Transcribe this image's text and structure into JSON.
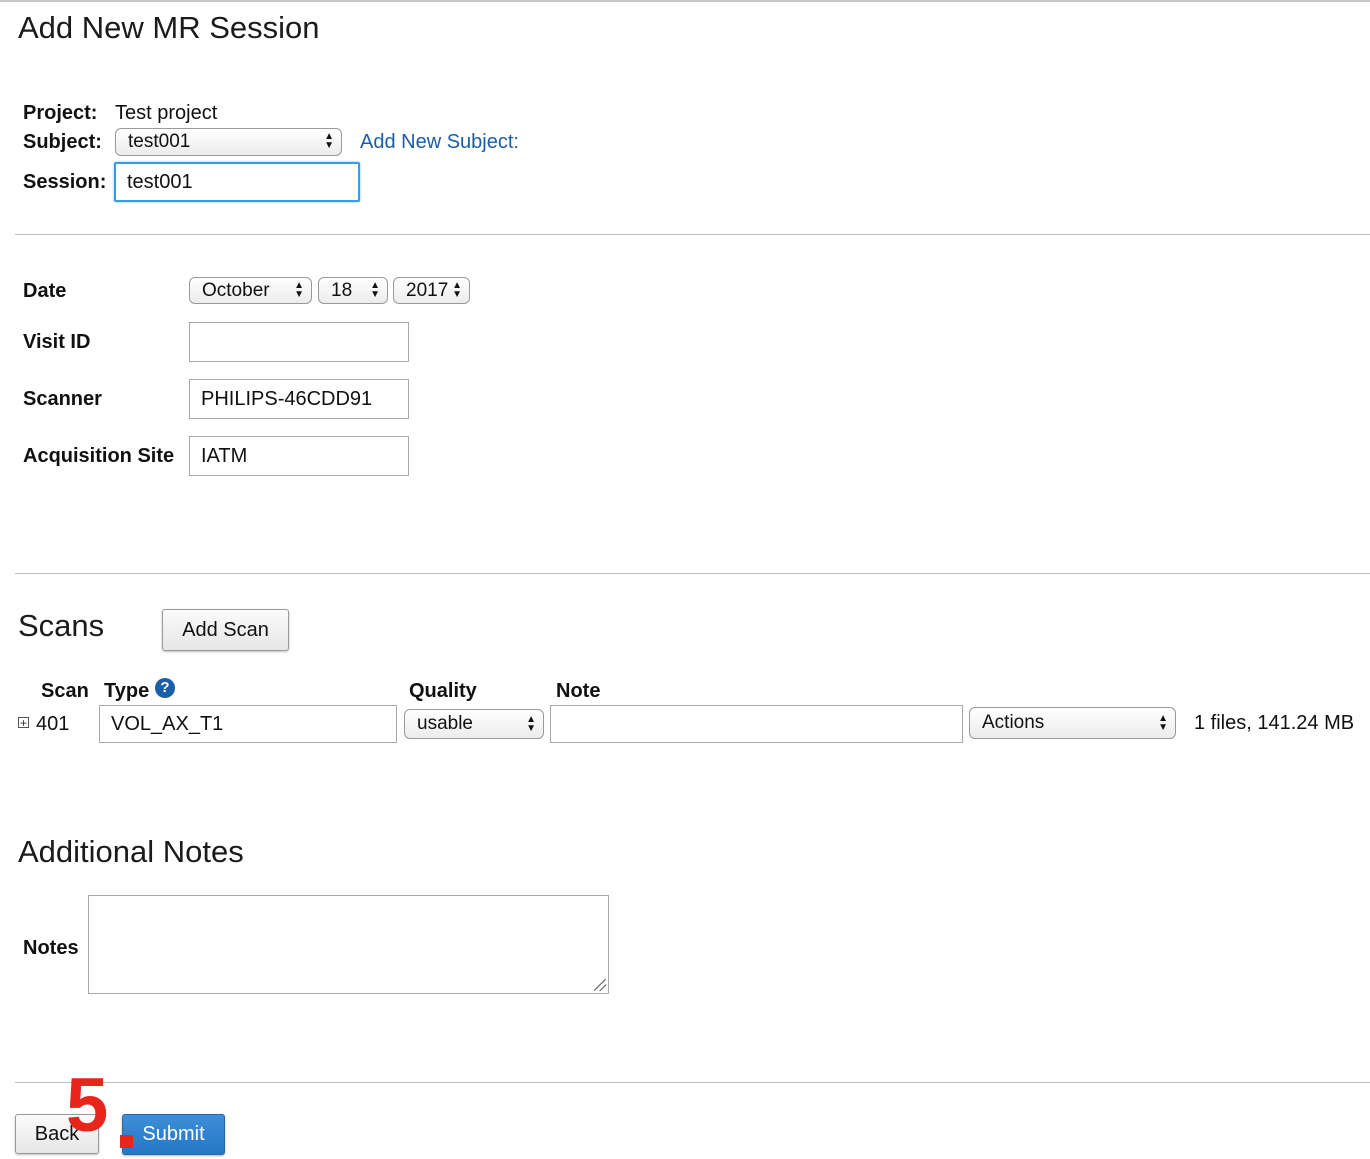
{
  "page": {
    "title": "Add New MR Session"
  },
  "header_fields": {
    "project_label": "Project:",
    "project_value": "Test project",
    "subject_label": "Subject:",
    "subject_value": "test001",
    "add_subject_link": "Add New Subject:",
    "session_label": "Session:",
    "session_value": "test001"
  },
  "details": {
    "date_label": "Date",
    "date_month": "October",
    "date_day": "18",
    "date_year": "2017",
    "visit_id_label": "Visit ID",
    "visit_id_value": "",
    "scanner_label": "Scanner",
    "scanner_value": "PHILIPS-46CDD91",
    "acq_site_label": "Acquisition Site",
    "acq_site_value": "IATM"
  },
  "scans": {
    "title": "Scans",
    "add_scan_label": "Add Scan",
    "columns": {
      "scan": "Scan",
      "type": "Type",
      "quality": "Quality",
      "note": "Note"
    },
    "help_icon_glyph": "?",
    "rows": [
      {
        "expand_glyph": "+",
        "scan_id": "401",
        "type": "VOL_AX_T1",
        "quality": "usable",
        "note": "",
        "actions": "Actions",
        "files": "1 files, 141.24 MB"
      }
    ]
  },
  "notes": {
    "title": "Additional Notes",
    "label": "Notes",
    "value": ""
  },
  "footer": {
    "back_label": "Back",
    "submit_label": "Submit"
  },
  "annotation": {
    "step_number": "5"
  },
  "colors": {
    "link": "#1a5ea8",
    "primary_button": "#2576c4",
    "focus_border": "#3b9be6",
    "annotation": "#e8241b"
  },
  "icons": {
    "select_arrows": "updown-arrows-icon",
    "help": "question-circle-icon",
    "expand": "plus-box-icon",
    "resize": "resize-grip-icon"
  }
}
